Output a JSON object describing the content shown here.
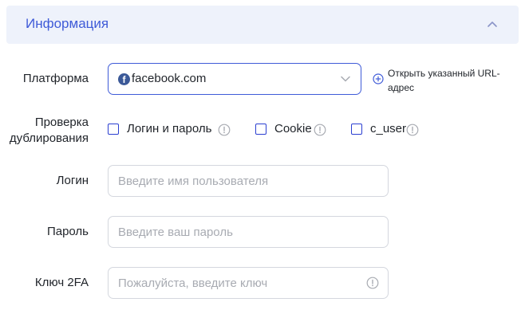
{
  "section": {
    "title": "Информация",
    "collapse_icon": "chevron-up-icon"
  },
  "platform": {
    "label": "Платформа",
    "value": "facebook.com",
    "icon": "facebook-icon",
    "icon_glyph": "f",
    "open_url_label": "Открыть указанный URL-адрес"
  },
  "duplication": {
    "label_line1": "Проверка",
    "label_line2": "дублирования",
    "options": [
      {
        "label": "Логин и пароль",
        "checked": false
      },
      {
        "label": "Cookie",
        "checked": false
      },
      {
        "label": "c_user",
        "checked": false
      }
    ]
  },
  "login": {
    "label": "Логин",
    "placeholder": "Введите имя пользователя"
  },
  "password": {
    "label": "Пароль",
    "placeholder": "Введите ваш пароль"
  },
  "twofa": {
    "label": "Ключ 2FA",
    "placeholder": "Пожалуйста, введите ключ"
  },
  "colors": {
    "accent": "#3f5bd8",
    "header_bg": "#eef2fb",
    "checkbox_border": "#2b3fd1",
    "facebook_blue": "#3b5998"
  }
}
